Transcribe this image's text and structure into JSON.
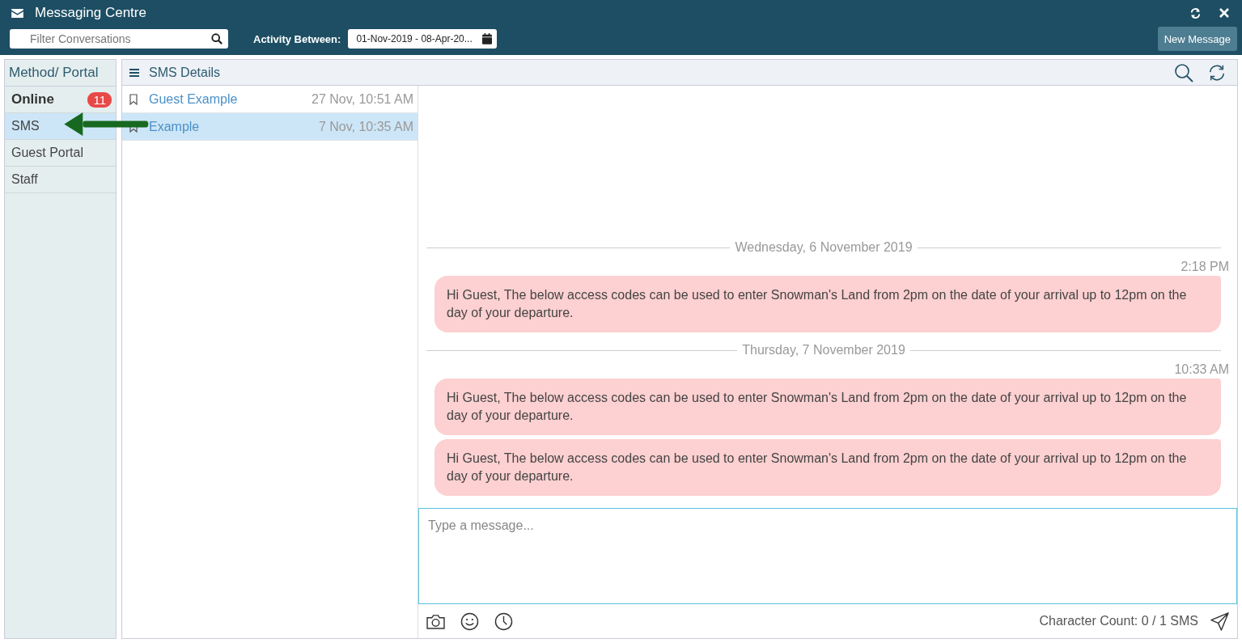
{
  "window": {
    "title": "Messaging Centre"
  },
  "toolbar": {
    "filter": {
      "placeholder": "Filter Conversations"
    },
    "activity_label": "Activity Between:",
    "date_range": "01-Nov-2019 - 08-Apr-20...",
    "new_message": "New Message"
  },
  "methods": {
    "heading": "Method/ Portal",
    "items": [
      {
        "label": "Online",
        "kind": "group",
        "badge": "11",
        "selected": false
      },
      {
        "label": "SMS",
        "kind": "item",
        "selected": true
      },
      {
        "label": "Guest Portal",
        "kind": "item",
        "selected": false
      },
      {
        "label": "Staff",
        "kind": "item",
        "selected": false
      }
    ]
  },
  "conversations": {
    "title": "SMS Details",
    "items": [
      {
        "name": "Guest Example",
        "time": "27 Nov, 10:51 AM",
        "selected": false
      },
      {
        "name": "Example",
        "time": "7 Nov, 10:35 AM",
        "selected": true
      }
    ]
  },
  "chat": {
    "days": [
      {
        "date": "Wednesday, 6 November 2019",
        "groups": [
          {
            "time": "2:18 PM",
            "messages": [
              "Hi Guest, The below access codes can be used to enter Snowman's Land from 2pm on the date of your arrival up to 12pm on the day of your departure."
            ]
          }
        ]
      },
      {
        "date": "Thursday, 7 November 2019",
        "groups": [
          {
            "time": "10:33 AM",
            "messages": [
              "Hi Guest, The below access codes can be used to enter Snowman's Land from 2pm on the date of your arrival up to 12pm on the day of your departure.",
              "Hi Guest, The below access codes can be used to enter Snowman's Land from 2pm on the date of your arrival up to 12pm on the day of your departure."
            ]
          }
        ]
      }
    ],
    "composer": {
      "placeholder": "Type a message..."
    },
    "character_count": "Character Count: 0 / 1 SMS"
  }
}
